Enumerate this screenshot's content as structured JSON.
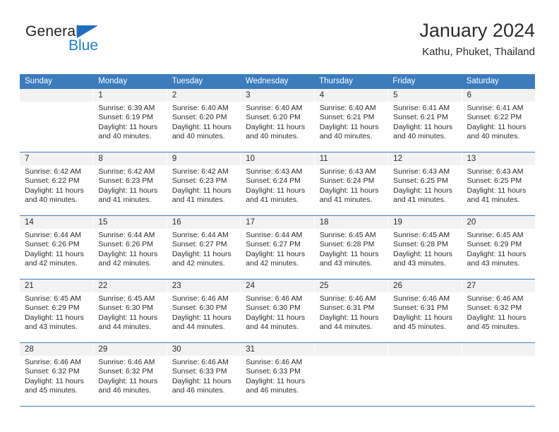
{
  "brand": {
    "name_part1": "General",
    "name_part2": "Blue",
    "color_primary": "#1b6ec2",
    "color_secondary": "#1b7fd4"
  },
  "header": {
    "title": "January 2024",
    "subtitle": "Kathu, Phuket, Thailand"
  },
  "theme": {
    "header_blue": "#3c7cbd",
    "daynum_band": "#f2f2f2",
    "text": "#2b2b2b"
  },
  "weekdays": [
    "Sunday",
    "Monday",
    "Tuesday",
    "Wednesday",
    "Thursday",
    "Friday",
    "Saturday"
  ],
  "labels": {
    "sunrise": "Sunrise:",
    "sunset": "Sunset:",
    "daylight": "Daylight:"
  },
  "weeks": [
    {
      "days": [
        {
          "num": "",
          "sunrise": "",
          "sunset": "",
          "daylight1": "",
          "daylight2": "",
          "empty": true
        },
        {
          "num": "1",
          "sunrise": "Sunrise: 6:39 AM",
          "sunset": "Sunset: 6:19 PM",
          "daylight1": "Daylight: 11 hours",
          "daylight2": "and 40 minutes.",
          "empty": false
        },
        {
          "num": "2",
          "sunrise": "Sunrise: 6:40 AM",
          "sunset": "Sunset: 6:20 PM",
          "daylight1": "Daylight: 11 hours",
          "daylight2": "and 40 minutes.",
          "empty": false
        },
        {
          "num": "3",
          "sunrise": "Sunrise: 6:40 AM",
          "sunset": "Sunset: 6:20 PM",
          "daylight1": "Daylight: 11 hours",
          "daylight2": "and 40 minutes.",
          "empty": false
        },
        {
          "num": "4",
          "sunrise": "Sunrise: 6:40 AM",
          "sunset": "Sunset: 6:21 PM",
          "daylight1": "Daylight: 11 hours",
          "daylight2": "and 40 minutes.",
          "empty": false
        },
        {
          "num": "5",
          "sunrise": "Sunrise: 6:41 AM",
          "sunset": "Sunset: 6:21 PM",
          "daylight1": "Daylight: 11 hours",
          "daylight2": "and 40 minutes.",
          "empty": false
        },
        {
          "num": "6",
          "sunrise": "Sunrise: 6:41 AM",
          "sunset": "Sunset: 6:22 PM",
          "daylight1": "Daylight: 11 hours",
          "daylight2": "and 40 minutes.",
          "empty": false
        }
      ]
    },
    {
      "days": [
        {
          "num": "7",
          "sunrise": "Sunrise: 6:42 AM",
          "sunset": "Sunset: 6:22 PM",
          "daylight1": "Daylight: 11 hours",
          "daylight2": "and 40 minutes.",
          "empty": false
        },
        {
          "num": "8",
          "sunrise": "Sunrise: 6:42 AM",
          "sunset": "Sunset: 6:23 PM",
          "daylight1": "Daylight: 11 hours",
          "daylight2": "and 41 minutes.",
          "empty": false
        },
        {
          "num": "9",
          "sunrise": "Sunrise: 6:42 AM",
          "sunset": "Sunset: 6:23 PM",
          "daylight1": "Daylight: 11 hours",
          "daylight2": "and 41 minutes.",
          "empty": false
        },
        {
          "num": "10",
          "sunrise": "Sunrise: 6:43 AM",
          "sunset": "Sunset: 6:24 PM",
          "daylight1": "Daylight: 11 hours",
          "daylight2": "and 41 minutes.",
          "empty": false
        },
        {
          "num": "11",
          "sunrise": "Sunrise: 6:43 AM",
          "sunset": "Sunset: 6:24 PM",
          "daylight1": "Daylight: 11 hours",
          "daylight2": "and 41 minutes.",
          "empty": false
        },
        {
          "num": "12",
          "sunrise": "Sunrise: 6:43 AM",
          "sunset": "Sunset: 6:25 PM",
          "daylight1": "Daylight: 11 hours",
          "daylight2": "and 41 minutes.",
          "empty": false
        },
        {
          "num": "13",
          "sunrise": "Sunrise: 6:43 AM",
          "sunset": "Sunset: 6:25 PM",
          "daylight1": "Daylight: 11 hours",
          "daylight2": "and 41 minutes.",
          "empty": false
        }
      ]
    },
    {
      "days": [
        {
          "num": "14",
          "sunrise": "Sunrise: 6:44 AM",
          "sunset": "Sunset: 6:26 PM",
          "daylight1": "Daylight: 11 hours",
          "daylight2": "and 42 minutes.",
          "empty": false
        },
        {
          "num": "15",
          "sunrise": "Sunrise: 6:44 AM",
          "sunset": "Sunset: 6:26 PM",
          "daylight1": "Daylight: 11 hours",
          "daylight2": "and 42 minutes.",
          "empty": false
        },
        {
          "num": "16",
          "sunrise": "Sunrise: 6:44 AM",
          "sunset": "Sunset: 6:27 PM",
          "daylight1": "Daylight: 11 hours",
          "daylight2": "and 42 minutes.",
          "empty": false
        },
        {
          "num": "17",
          "sunrise": "Sunrise: 6:44 AM",
          "sunset": "Sunset: 6:27 PM",
          "daylight1": "Daylight: 11 hours",
          "daylight2": "and 42 minutes.",
          "empty": false
        },
        {
          "num": "18",
          "sunrise": "Sunrise: 6:45 AM",
          "sunset": "Sunset: 6:28 PM",
          "daylight1": "Daylight: 11 hours",
          "daylight2": "and 43 minutes.",
          "empty": false
        },
        {
          "num": "19",
          "sunrise": "Sunrise: 6:45 AM",
          "sunset": "Sunset: 6:28 PM",
          "daylight1": "Daylight: 11 hours",
          "daylight2": "and 43 minutes.",
          "empty": false
        },
        {
          "num": "20",
          "sunrise": "Sunrise: 6:45 AM",
          "sunset": "Sunset: 6:29 PM",
          "daylight1": "Daylight: 11 hours",
          "daylight2": "and 43 minutes.",
          "empty": false
        }
      ]
    },
    {
      "days": [
        {
          "num": "21",
          "sunrise": "Sunrise: 6:45 AM",
          "sunset": "Sunset: 6:29 PM",
          "daylight1": "Daylight: 11 hours",
          "daylight2": "and 43 minutes.",
          "empty": false
        },
        {
          "num": "22",
          "sunrise": "Sunrise: 6:45 AM",
          "sunset": "Sunset: 6:30 PM",
          "daylight1": "Daylight: 11 hours",
          "daylight2": "and 44 minutes.",
          "empty": false
        },
        {
          "num": "23",
          "sunrise": "Sunrise: 6:46 AM",
          "sunset": "Sunset: 6:30 PM",
          "daylight1": "Daylight: 11 hours",
          "daylight2": "and 44 minutes.",
          "empty": false
        },
        {
          "num": "24",
          "sunrise": "Sunrise: 6:46 AM",
          "sunset": "Sunset: 6:30 PM",
          "daylight1": "Daylight: 11 hours",
          "daylight2": "and 44 minutes.",
          "empty": false
        },
        {
          "num": "25",
          "sunrise": "Sunrise: 6:46 AM",
          "sunset": "Sunset: 6:31 PM",
          "daylight1": "Daylight: 11 hours",
          "daylight2": "and 44 minutes.",
          "empty": false
        },
        {
          "num": "26",
          "sunrise": "Sunrise: 6:46 AM",
          "sunset": "Sunset: 6:31 PM",
          "daylight1": "Daylight: 11 hours",
          "daylight2": "and 45 minutes.",
          "empty": false
        },
        {
          "num": "27",
          "sunrise": "Sunrise: 6:46 AM",
          "sunset": "Sunset: 6:32 PM",
          "daylight1": "Daylight: 11 hours",
          "daylight2": "and 45 minutes.",
          "empty": false
        }
      ]
    },
    {
      "days": [
        {
          "num": "28",
          "sunrise": "Sunrise: 6:46 AM",
          "sunset": "Sunset: 6:32 PM",
          "daylight1": "Daylight: 11 hours",
          "daylight2": "and 45 minutes.",
          "empty": false
        },
        {
          "num": "29",
          "sunrise": "Sunrise: 6:46 AM",
          "sunset": "Sunset: 6:32 PM",
          "daylight1": "Daylight: 11 hours",
          "daylight2": "and 46 minutes.",
          "empty": false
        },
        {
          "num": "30",
          "sunrise": "Sunrise: 6:46 AM",
          "sunset": "Sunset: 6:33 PM",
          "daylight1": "Daylight: 11 hours",
          "daylight2": "and 46 minutes.",
          "empty": false
        },
        {
          "num": "31",
          "sunrise": "Sunrise: 6:46 AM",
          "sunset": "Sunset: 6:33 PM",
          "daylight1": "Daylight: 11 hours",
          "daylight2": "and 46 minutes.",
          "empty": false
        },
        {
          "num": "",
          "sunrise": "",
          "sunset": "",
          "daylight1": "",
          "daylight2": "",
          "empty": true
        },
        {
          "num": "",
          "sunrise": "",
          "sunset": "",
          "daylight1": "",
          "daylight2": "",
          "empty": true
        },
        {
          "num": "",
          "sunrise": "",
          "sunset": "",
          "daylight1": "",
          "daylight2": "",
          "empty": true
        }
      ]
    }
  ]
}
